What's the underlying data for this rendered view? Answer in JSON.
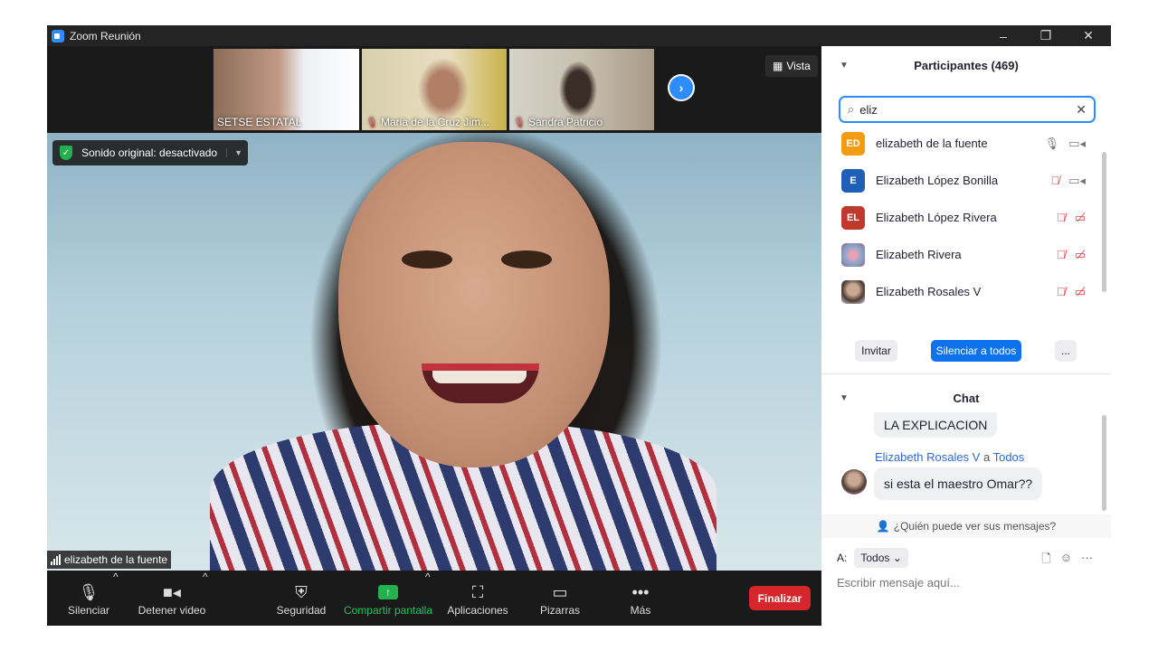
{
  "window": {
    "title": "Zoom Reunión",
    "controls": {
      "minimize": "–",
      "restore": "❐",
      "close": "✕"
    }
  },
  "thumbnails": [
    {
      "name": "SETSE ESTATAL",
      "muted": false
    },
    {
      "name": "Maria de la Cruz Jim...",
      "muted": true
    },
    {
      "name": "Sandra Patricio",
      "muted": true
    }
  ],
  "view_button": {
    "label": "Vista",
    "icon": "grid-icon"
  },
  "sound_bar": {
    "label": "Sonido original: desactivado"
  },
  "active_speaker": {
    "name": "elizabeth de la fuente"
  },
  "toolbar": {
    "mute": "Silenciar",
    "video": "Detener video",
    "security": "Seguridad",
    "share": "Compartir pantalla",
    "apps": "Aplicaciones",
    "whiteboards": "Pizarras",
    "more": "Más",
    "end": "Finalizar"
  },
  "participants": {
    "header": "Participantes (469)",
    "search_value": "eliz",
    "list": [
      {
        "initials": "ED",
        "name": "elizabeth de la fuente",
        "color": "#f39c12",
        "mic_muted": false,
        "video_off": false
      },
      {
        "initials": "E",
        "name": "Elizabeth López Bonilla",
        "color": "#1f5fb5",
        "mic_muted": true,
        "video_off": false
      },
      {
        "initials": "EL",
        "name": "Elizabeth López Rivera",
        "color": "#c0392b",
        "mic_muted": true,
        "video_off": true
      },
      {
        "initials": "",
        "name": "Elizabeth Rivera",
        "color": "#b05a7a",
        "mic_muted": true,
        "video_off": true
      },
      {
        "initials": "",
        "name": "Elizabeth Rosales V",
        "color": "#8a7b74",
        "mic_muted": true,
        "video_off": true
      }
    ],
    "invite": "Invitar",
    "mute_all": "Silenciar a todos",
    "more": "..."
  },
  "chat": {
    "header": "Chat",
    "partial_message": "LA EXPLICACION",
    "sender": "Elizabeth Rosales V",
    "to_word": "a",
    "recipient": "Todos",
    "message": "si esta el maestro Omar??",
    "who_can_see": "¿Quién puede ver sus mensajes?",
    "to_label": "A:",
    "to_value": "Todos",
    "placeholder": "Escribir mensaje aquí..."
  }
}
